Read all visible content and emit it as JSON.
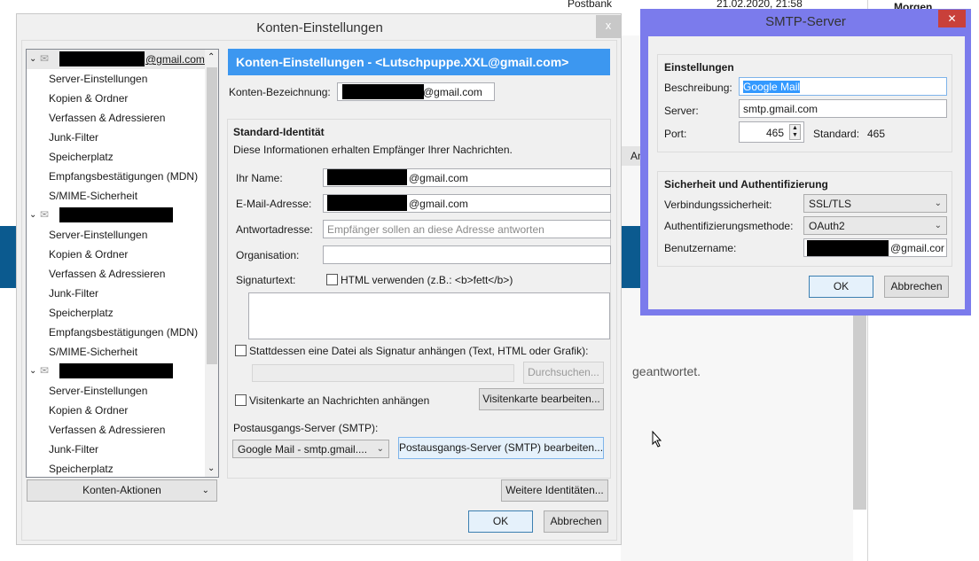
{
  "background": {
    "postbank": "Postbank",
    "date": "21.02.2020, 21:58",
    "morgen": "Morgen",
    "answered": "geantwortet.",
    "an_fragment": "An"
  },
  "main_dialog": {
    "title": "Konten-Einstellungen",
    "close": "x",
    "tree": {
      "accounts": [
        {
          "name": "@gmail.com",
          "items": [
            "Server-Einstellungen",
            "Kopien & Ordner",
            "Verfassen & Adressieren",
            "Junk-Filter",
            "Speicherplatz",
            "Empfangsbestätigungen (MDN)",
            "S/MIME-Sicherheit"
          ]
        },
        {
          "name": "",
          "items": [
            "Server-Einstellungen",
            "Kopien & Ordner",
            "Verfassen & Adressieren",
            "Junk-Filter",
            "Speicherplatz",
            "Empfangsbestätigungen (MDN)",
            "S/MIME-Sicherheit"
          ]
        },
        {
          "name": "",
          "items": [
            "Server-Einstellungen",
            "Kopien & Ordner",
            "Verfassen & Adressieren",
            "Junk-Filter",
            "Speicherplatz"
          ]
        }
      ]
    },
    "account_actions": "Konten-Aktionen",
    "header": "Konten-Einstellungen - <Lutschpuppe.XXL@gmail.com>",
    "account_name_label": "Konten-Bezeichnung:",
    "account_name_value": "@gmail.com",
    "identity": {
      "title": "Standard-Identität",
      "desc": "Diese Informationen erhalten Empfänger Ihrer Nachrichten.",
      "name_label": "Ihr Name:",
      "name_value": "@gmail.com",
      "email_label": "E-Mail-Adresse:",
      "email_value": "@gmail.com",
      "reply_label": "Antwortadresse:",
      "reply_placeholder": "Empfänger sollen an diese Adresse antworten",
      "org_label": "Organisation:",
      "org_value": "",
      "sig_label": "Signaturtext:",
      "html_check": "HTML verwenden (z.B.: <b>fett</b>)",
      "file_check": "Stattdessen eine Datei als Signatur anhängen (Text, HTML oder Grafik):",
      "browse": "Durchsuchen...",
      "vcard_check": "Visitenkarte an Nachrichten anhängen",
      "vcard_edit": "Visitenkarte bearbeiten...",
      "smtp_label": "Postausgangs-Server (SMTP):",
      "smtp_select": "Google Mail - smtp.gmail....",
      "smtp_edit": "Postausgangs-Server (SMTP) bearbeiten..."
    },
    "more_identities": "Weitere Identitäten...",
    "ok": "OK",
    "cancel": "Abbrechen"
  },
  "smtp_dialog": {
    "title": "SMTP-Server",
    "close": "✕",
    "settings_title": "Einstellungen",
    "desc_label": "Beschreibung:",
    "desc_value": "Google Mail",
    "server_label": "Server:",
    "server_value": "smtp.gmail.com",
    "port_label": "Port:",
    "port_value": "465",
    "default_label": "Standard:",
    "default_value": "465",
    "security_title": "Sicherheit und Authentifizierung",
    "conn_label": "Verbindungssicherheit:",
    "conn_value": "SSL/TLS",
    "auth_label": "Authentifizierungsmethode:",
    "auth_value": "OAuth2",
    "user_label": "Benutzername:",
    "user_value": "@gmail.cor",
    "ok": "OK",
    "cancel": "Abbrechen"
  },
  "colors": {
    "header_blue": "#3c97f0",
    "smtp_border": "#7b7bec",
    "close_red": "#c9403a"
  }
}
